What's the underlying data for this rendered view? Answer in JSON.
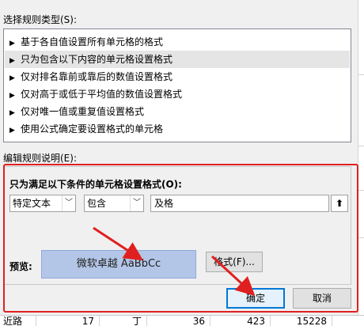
{
  "dialog": {
    "select_rule_type_label": "选择规则类型(S):",
    "rule_types": [
      "基于各自值设置所有单元格的格式",
      "只为包含以下内容的单元格设置格式",
      "仅对排名靠前或靠后的数值设置格式",
      "仅对高于或低于平均值的数值设置格式",
      "仅对唯一值或重复值设置格式",
      "使用公式确定要设置格式的单元格"
    ],
    "selected_index": 1,
    "edit_rule_label": "编辑规则说明(E):",
    "condition_header": "只为满足以下条件的单元格设置格式(O):",
    "condition": {
      "type_value": "特定文本",
      "operator_value": "包含",
      "text_value": "及格"
    },
    "preview_label": "预览:",
    "preview_sample": "微软卓越  AaBbCc",
    "format_button": "格式(F)...",
    "ok_button": "确定",
    "cancel_button": "取消"
  },
  "background_sheet": {
    "bottom_row": [
      "近路",
      "17",
      "丁",
      "36",
      "423",
      "15228"
    ]
  },
  "colors": {
    "highlight_annotation": "#e02020",
    "preview_fill": "#b4c6e7",
    "primary_button_border": "#0078d7"
  }
}
